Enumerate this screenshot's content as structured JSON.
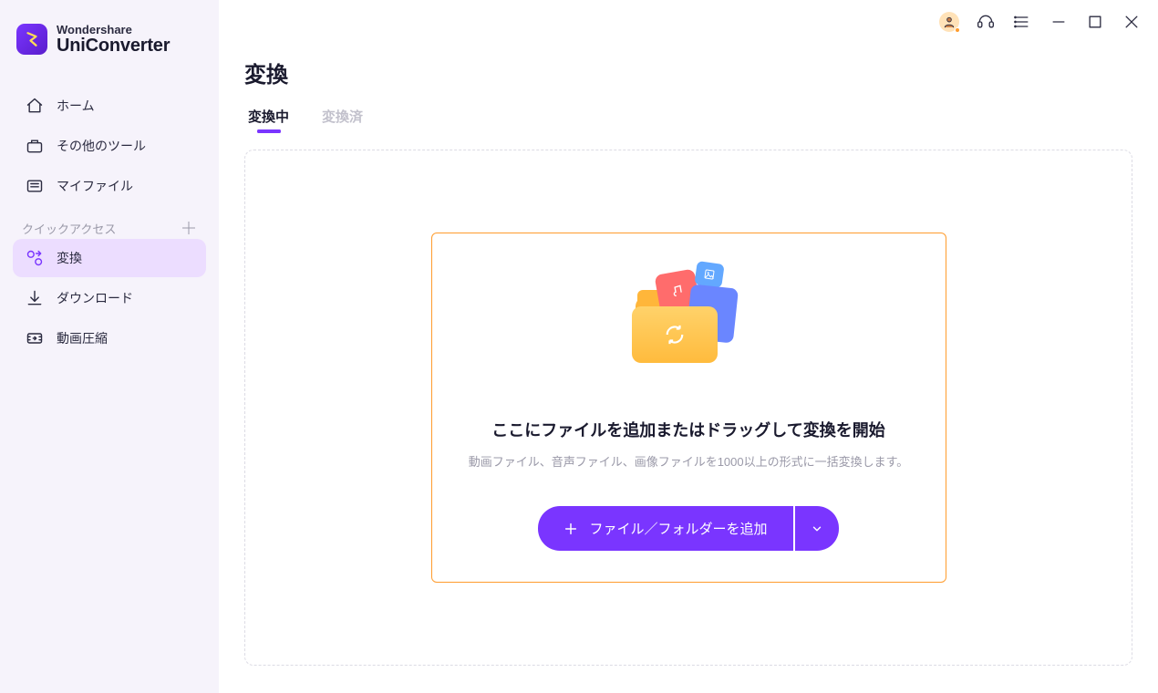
{
  "brand": {
    "line1": "Wondershare",
    "line2": "UniConverter"
  },
  "sidebar": {
    "items": [
      {
        "label": "ホーム",
        "icon": "home-icon"
      },
      {
        "label": "その他のツール",
        "icon": "toolbox-icon"
      },
      {
        "label": "マイファイル",
        "icon": "folder-icon"
      }
    ],
    "quick_label": "クイックアクセス",
    "quick_items": [
      {
        "label": "変換",
        "icon": "convert-icon"
      },
      {
        "label": "ダウンロード",
        "icon": "download-icon"
      },
      {
        "label": "動画圧縮",
        "icon": "compress-icon"
      }
    ],
    "active_item": "変換"
  },
  "page": {
    "title": "変換",
    "tabs": [
      {
        "label": "変換中",
        "active": true
      },
      {
        "label": "変換済",
        "active": false
      }
    ]
  },
  "dropzone": {
    "title": "ここにファイルを追加またはドラッグして変換を開始",
    "subtitle": "動画ファイル、音声ファイル、画像ファイルを1000以上の形式に一括変換します。",
    "add_button_label": "ファイル／フォルダーを追加"
  }
}
